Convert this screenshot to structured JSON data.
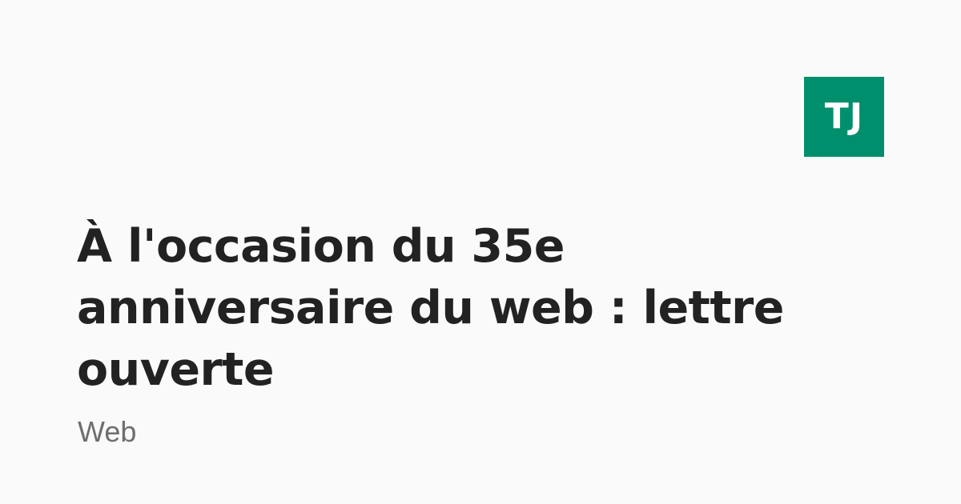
{
  "colors": {
    "background": "#fafafa",
    "logo_background": "#008f6c",
    "title": "#222222",
    "category": "#6e6e6e"
  },
  "logo": {
    "text": "TJ"
  },
  "article": {
    "title": "À l'occasion du 35e anniversaire du web : lettre ouverte",
    "category": "Web"
  }
}
